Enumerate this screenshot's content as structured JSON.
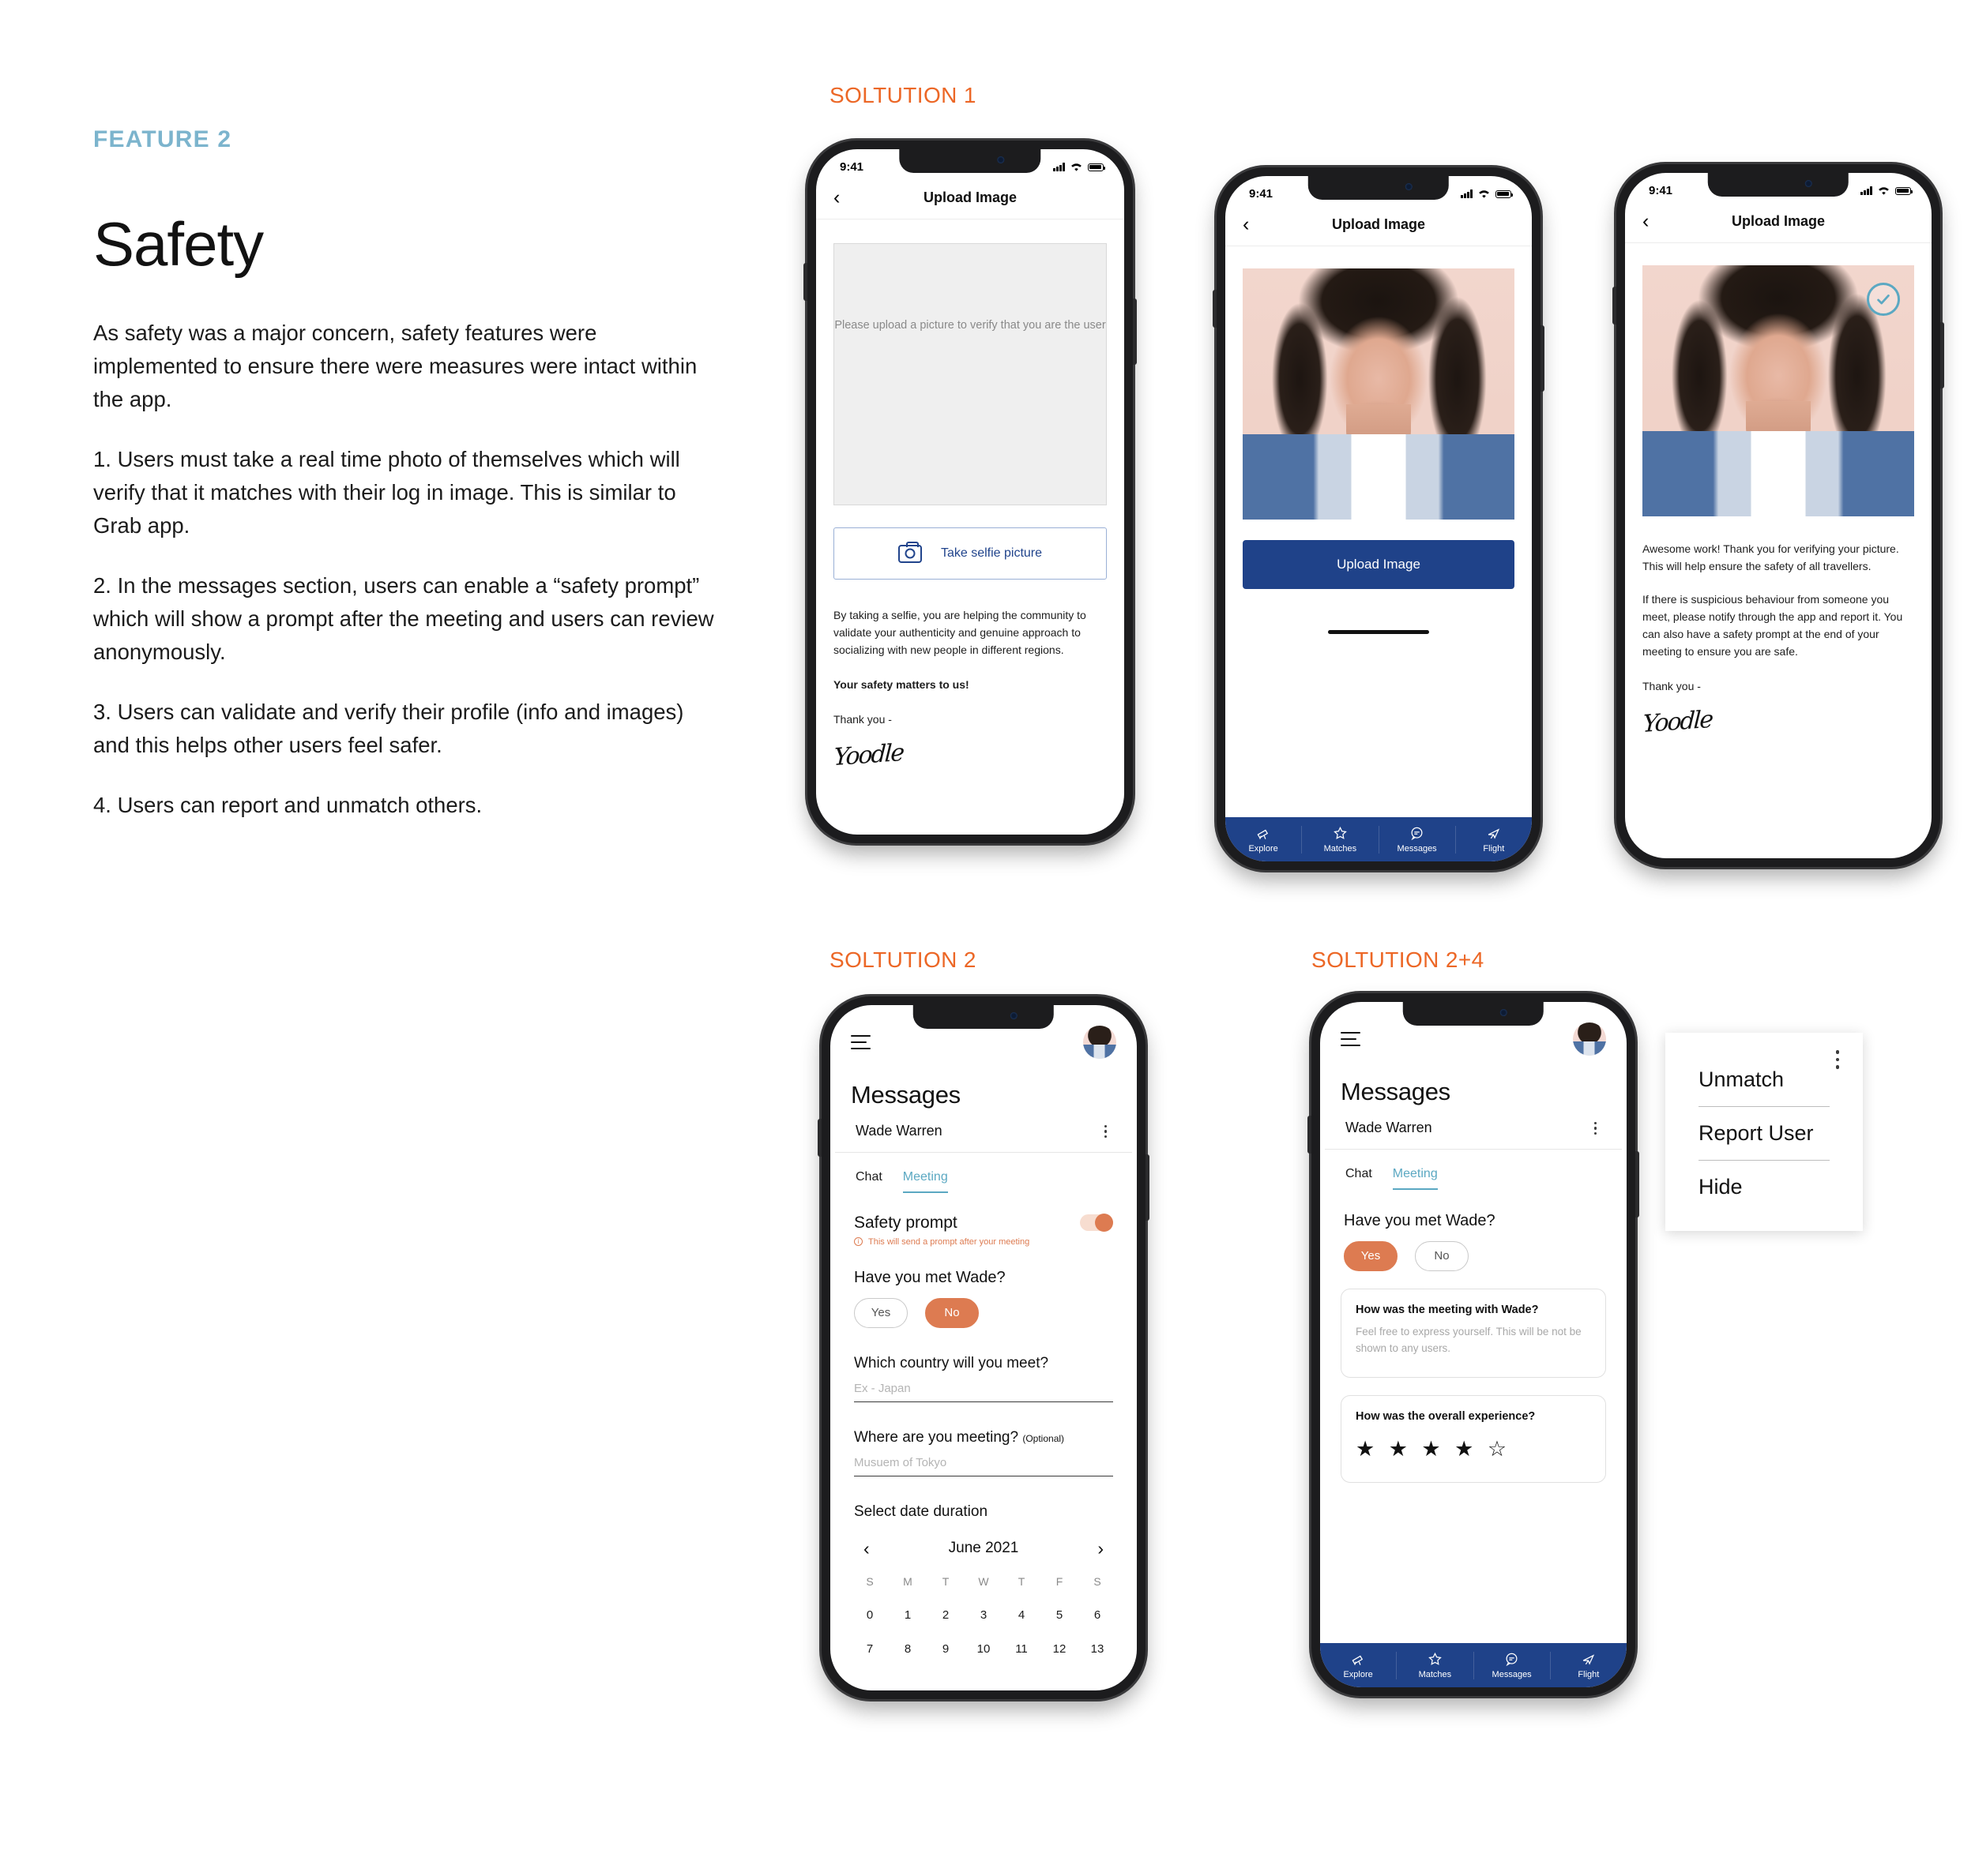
{
  "left": {
    "kicker": "FEATURE 2",
    "title": "Safety",
    "paragraphs": [
      "As safety was a major concern, safety features were implemented to ensure there were measures were intact within the app.",
      "1. Users must take a real time photo of themselves which will verify that it matches with their log in image. This is similar to Grab app.",
      "2. In the messages section, users can enable a “safety prompt” which will show a prompt after the meeting and users can review anonymously.",
      "3. Users can validate and verify their profile (info and images) and this helps other users feel safer.",
      "4. Users can report and unmatch others."
    ]
  },
  "labels": {
    "solution1": "SOLTUTION 1",
    "solution2": "SOLTUTION 2",
    "solution24": "SOLTUTION 2+4"
  },
  "status": {
    "time": "9:41"
  },
  "phone1": {
    "nav_title": "Upload Image",
    "back": "‹",
    "placeholder": "Please upload a picture to verify that you are the user",
    "selfie_button": "Take selfie picture",
    "copy": "By taking a selfie, you are helping the community to validate your authenticity and genuine approach to socializing with new people in different regions.",
    "bold_line": "Your safety matters to us!",
    "thanks": "Thank you -",
    "signature": "Yoodle"
  },
  "phone2": {
    "nav_title": "Upload Image",
    "back": "‹",
    "upload_button": "Upload Image"
  },
  "phone3": {
    "nav_title": "Upload Image",
    "back": "‹",
    "copy1": "Awesome work! Thank you for verifying your picture. This will help ensure the safety of all travellers.",
    "copy2": "If there is suspicious behaviour from someone you meet, please notify through the app and report it. You can also have a safety prompt at the end of your meeting to ensure you are safe.",
    "thanks": "Thank you -",
    "signature": "Yoodle"
  },
  "tabbar": {
    "items": [
      {
        "label": "Explore",
        "icon": "telescope-icon"
      },
      {
        "label": "Matches",
        "icon": "star-icon"
      },
      {
        "label": "Messages",
        "icon": "chat-bubble-icon"
      },
      {
        "label": "Flight",
        "icon": "airplane-icon"
      }
    ]
  },
  "messages2": {
    "title": "Messages",
    "person": "Wade Warren",
    "tabs": [
      {
        "label": "Chat",
        "active": false
      },
      {
        "label": "Meeting",
        "active": true
      }
    ],
    "safety_prompt_label": "Safety prompt",
    "safety_prompt_hint": "This will send a prompt after your meeting",
    "met_question": "Have you met Wade?",
    "yes": "Yes",
    "no": "No",
    "selected": "No",
    "country_label": "Which country will you meet?",
    "country_placeholder": "Ex - Japan",
    "where_label": "Where are you meeting?",
    "where_optional": "(Optional)",
    "where_placeholder": "Musuem of Tokyo",
    "date_label": "Select date duration",
    "calendar": {
      "month": "June 2021",
      "prev": "‹",
      "next": "›",
      "dows": [
        "S",
        "M",
        "T",
        "W",
        "T",
        "F",
        "S"
      ],
      "week1": [
        "0",
        "1",
        "2",
        "3",
        "4",
        "5",
        "6"
      ],
      "week2": [
        "7",
        "8",
        "9",
        "10",
        "11",
        "12",
        "13"
      ]
    }
  },
  "messages24": {
    "title": "Messages",
    "person": "Wade Warren",
    "tabs": [
      {
        "label": "Chat",
        "active": false
      },
      {
        "label": "Meeting",
        "active": true
      }
    ],
    "met_question": "Have you met Wade?",
    "yes": "Yes",
    "no": "No",
    "selected": "Yes",
    "review_card": {
      "question": "How was the meeting with Wade?",
      "placeholder": "Feel free to express yourself. This will be not be shown to any users."
    },
    "rating_card": {
      "question": "How was the overall experience?",
      "stars": "★ ★ ★ ★ ☆",
      "rating": 4,
      "max": 5
    }
  },
  "dropdown": {
    "items": [
      "Unmatch",
      "Report User",
      "Hide"
    ]
  },
  "colors": {
    "accent_blue": "#7cb4cd",
    "accent_orange": "#ec6726",
    "brand_navy": "#1f4289",
    "pill_orange": "#dd7b51"
  }
}
